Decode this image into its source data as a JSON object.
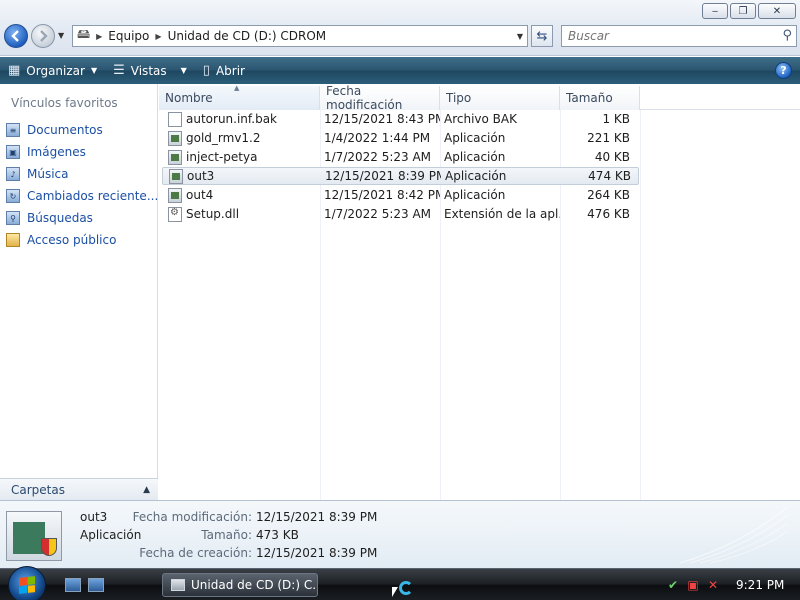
{
  "window": {
    "caption_buttons": {
      "minimize": "‒",
      "maximize": "❐",
      "close": "✕"
    }
  },
  "address_bar": {
    "segments": [
      "Equipo",
      "Unidad de CD (D:) CDROM"
    ]
  },
  "search": {
    "placeholder": "Buscar"
  },
  "toolbar": {
    "organize_label": "Organizar",
    "views_label": "Vistas",
    "open_label": "Abrir",
    "help_label": "?"
  },
  "nav_pane": {
    "favorites_title": "Vínculos favoritos",
    "items": [
      {
        "label": "Documentos",
        "icon": "documents-icon"
      },
      {
        "label": "Imágenes",
        "icon": "pictures-icon"
      },
      {
        "label": "Música",
        "icon": "music-icon"
      },
      {
        "label": "Cambiados reciente...",
        "icon": "recent-icon"
      },
      {
        "label": "Búsquedas",
        "icon": "searches-icon"
      },
      {
        "label": "Acceso público",
        "icon": "public-folder-icon"
      }
    ],
    "folders_label": "Carpetas"
  },
  "file_list": {
    "columns": [
      "Nombre",
      "Fecha modificación",
      "Tipo",
      "Tamaño"
    ],
    "rows": [
      {
        "name": "autorun.inf.bak",
        "date": "12/15/2021 8:43 PM",
        "type": "Archivo BAK",
        "size": "1 KB",
        "icon": "file-icon"
      },
      {
        "name": "gold_rmv1.2",
        "date": "1/4/2022 1:44 PM",
        "type": "Aplicación",
        "size": "221 KB",
        "icon": "application-icon"
      },
      {
        "name": "inject-petya",
        "date": "1/7/2022 5:23 AM",
        "type": "Aplicación",
        "size": "40 KB",
        "icon": "application-icon"
      },
      {
        "name": "out3",
        "date": "12/15/2021 8:39 PM",
        "type": "Aplicación",
        "size": "474 KB",
        "icon": "application-icon",
        "selected": true
      },
      {
        "name": "out4",
        "date": "12/15/2021 8:42 PM",
        "type": "Aplicación",
        "size": "264 KB",
        "icon": "application-icon"
      },
      {
        "name": "Setup.dll",
        "date": "1/7/2022 5:23 AM",
        "type": "Extensión de la apl...",
        "size": "476 KB",
        "icon": "dll-icon"
      }
    ]
  },
  "details_pane": {
    "name": "out3",
    "type": "Aplicación",
    "props": [
      {
        "label": "Fecha modificación:",
        "value": "12/15/2021 8:39 PM"
      },
      {
        "label": "Tamaño:",
        "value": "473 KB"
      },
      {
        "label": "Fecha de creación:",
        "value": "12/15/2021 8:39 PM"
      }
    ]
  },
  "taskbar": {
    "task_label": "Unidad de CD (D:) C...",
    "clock": "9:21 PM"
  }
}
